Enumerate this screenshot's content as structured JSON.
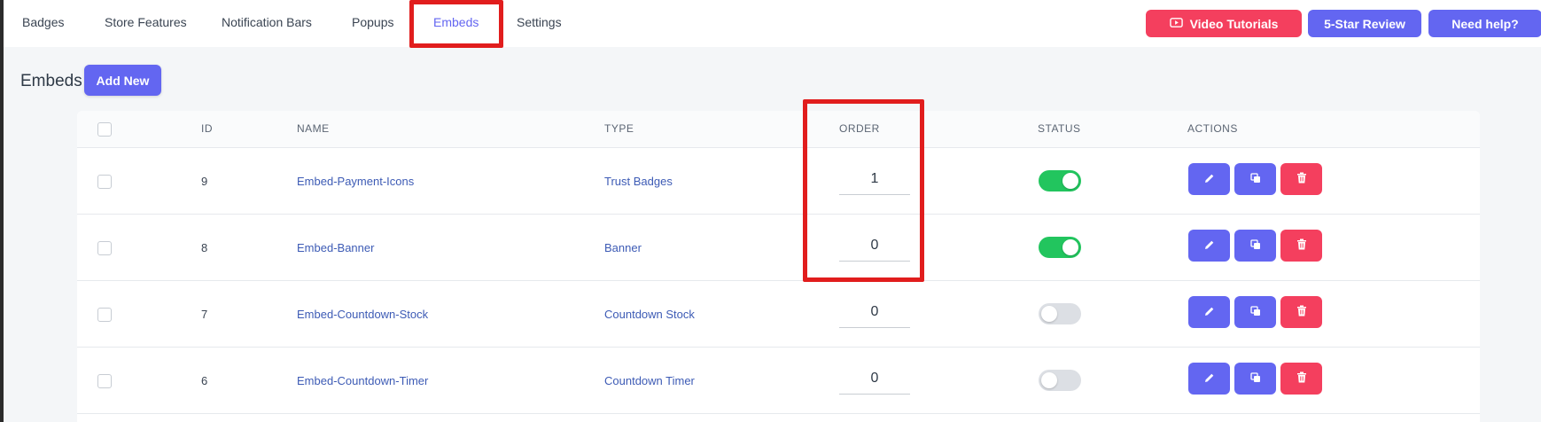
{
  "nav": {
    "tabs": [
      {
        "label": "Badges"
      },
      {
        "label": "Store Features"
      },
      {
        "label": "Notification Bars"
      },
      {
        "label": "Popups"
      },
      {
        "label": "Embeds"
      },
      {
        "label": "Settings"
      }
    ],
    "active": "Embeds"
  },
  "header_buttons": {
    "video": "Video Tutorials",
    "review": "5-Star Review",
    "help": "Need help?"
  },
  "page": {
    "title": "Embeds",
    "add_label": "Add New"
  },
  "table": {
    "columns": [
      "ID",
      "NAME",
      "TYPE",
      "ORDER",
      "STATUS",
      "ACTIONS"
    ],
    "rows": [
      {
        "id": "9",
        "name": "Embed-Payment-Icons",
        "type": "Trust Badges",
        "order": "1",
        "status": "on"
      },
      {
        "id": "8",
        "name": "Embed-Banner",
        "type": "Banner",
        "order": "0",
        "status": "on"
      },
      {
        "id": "7",
        "name": "Embed-Countdown-Stock",
        "type": "Countdown Stock",
        "order": "0",
        "status": "off"
      },
      {
        "id": "6",
        "name": "Embed-Countdown-Timer",
        "type": "Countdown Timer",
        "order": "0",
        "status": "off"
      }
    ]
  },
  "colors": {
    "accent": "#6366f1",
    "danger": "#f43f5e",
    "success": "#22c55e",
    "highlight": "#e11d1d"
  },
  "icons": {
    "video": "play-circle-icon",
    "edit": "pencil-icon",
    "copy": "copy-icon",
    "delete": "trash-icon"
  }
}
